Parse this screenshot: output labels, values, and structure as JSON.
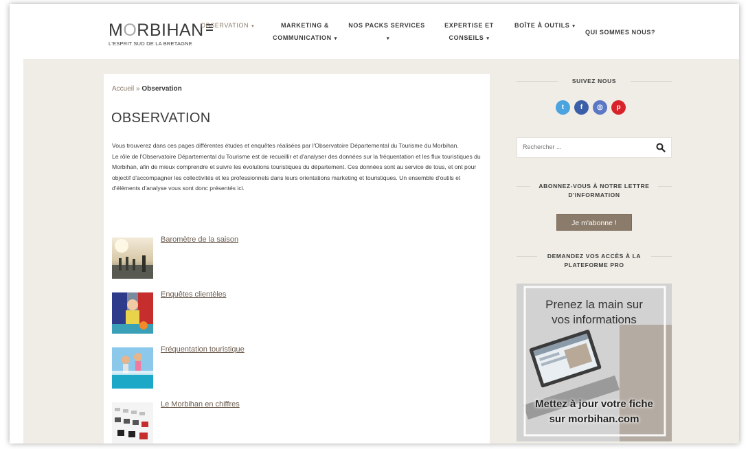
{
  "logo": {
    "name_part1": "M",
    "name_mark": "O",
    "name_part2": "RBIHAN",
    "tagline": "L'ESPRIT SUD DE LA BRETAGNE"
  },
  "nav": {
    "observation": "OBSERVATION",
    "marketing_line1": "MARKETING &",
    "marketing_line2": "COMMUNICATION",
    "packs_line1": "NOS PACKS SERVICES",
    "expertise_line1": "EXPERTISE ET",
    "expertise_line2": "CONSEILS",
    "boite": "BOÎTE À OUTILS",
    "qui": "QUI SOMMES NOUS?",
    "caret": "▾"
  },
  "breadcrumb": {
    "home": "Accueil",
    "sep": "»",
    "current": "Observation"
  },
  "page": {
    "title": "OBSERVATION",
    "intro_p1": "Vous trouverez dans ces pages différentes études et enquêtes réalisées par l'Observatoire Départemental du Tourisme du Morbihan.",
    "intro_p2": "Le rôle de l'Observatoire Départemental du Tourisme est de recueillir et d'analyser des données sur la fréquentation et les flux touristiques du Morbihan, afin de mieux comprendre et suivre les évolutions touristiques du département. Ces données sont au service de tous, et ont pour objectif d'accompagner les collectivités et les professionnels dans leurs orientations marketing et touristiques. Un ensemble d'outils et d'éléments d'analyse vous sont donc présentés ici."
  },
  "items": [
    {
      "label": "Baromètre de la saison"
    },
    {
      "label": "Enquêtes clientèles"
    },
    {
      "label": "Fréquentation touristique"
    },
    {
      "label": "Le Morbihan en chiffres"
    }
  ],
  "sidebar": {
    "follow_title": "SUIVEZ NOUS",
    "search_placeholder": "Rechercher ...",
    "newsletter_line1": "ABONNEZ-VOUS À NOTRE LETTRE",
    "newsletter_line2": "D'INFORMATION",
    "subscribe_label": "Je m'abonne !",
    "pro_line1": "DEMANDEZ VOS ACCÈS À LA",
    "pro_line2": "PLATEFORME PRO",
    "promo_top_line1": "Prenez la main sur",
    "promo_top_line2": "vos informations",
    "promo_bottom_line1": "Mettez à jour votre fiche",
    "promo_bottom_line2": "sur morbihan.com"
  },
  "socials": [
    {
      "icon": "twitter-icon",
      "glyph": "t",
      "color": "#4ba3e0"
    },
    {
      "icon": "facebook-icon",
      "glyph": "f",
      "color": "#3b5ea8"
    },
    {
      "icon": "instagram-icon",
      "glyph": "◎",
      "color": "#5a78c6"
    },
    {
      "icon": "pinterest-icon",
      "glyph": "p",
      "color": "#d8232a"
    }
  ],
  "colors": {
    "accent": "#8b7b6a",
    "band": "#efede5",
    "text": "#3b3b3b"
  }
}
